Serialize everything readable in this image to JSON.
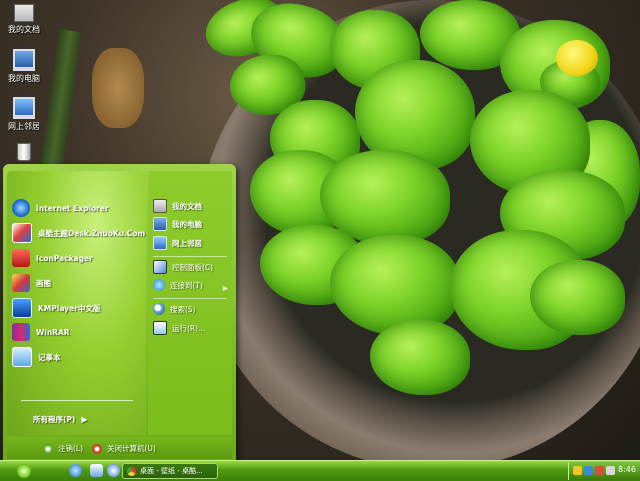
{
  "desktop": {
    "icons": [
      {
        "label": "我的文档",
        "icon": "documents-icon"
      },
      {
        "label": "我的电脑",
        "icon": "computer-icon"
      },
      {
        "label": "网上邻居",
        "icon": "network-icon"
      },
      {
        "label": "",
        "icon": "recycle-bin-icon"
      }
    ]
  },
  "start_menu": {
    "pinned": [
      {
        "label": "Internet Explorer",
        "icon": "ie-icon"
      },
      {
        "label": "桌酷主题Desk.ZhuoKu.Com",
        "icon": "zhuoku-icon"
      },
      {
        "label": "IconPackager",
        "icon": "iconpackager-icon"
      },
      {
        "label": "画图",
        "icon": "paint-icon"
      },
      {
        "label": "KMPlayer中文版",
        "icon": "kmplayer-icon"
      },
      {
        "label": "WinRAR",
        "icon": "winrar-icon"
      },
      {
        "label": "记事本",
        "icon": "notepad-icon"
      }
    ],
    "all_programs": "所有程序(P)",
    "all_programs_arrow": "▶",
    "right": {
      "my_documents": "我的文档",
      "my_computer": "我的电脑",
      "network": "网上邻居",
      "control_panel": "控制面板(C)",
      "connect_to": "连接到(T)",
      "connect_arrow": "▶",
      "search": "搜索(S)",
      "run": "运行(R)..."
    },
    "log_off": "注销(L)",
    "shut_down": "关闭计算机(U)"
  },
  "taskbar": {
    "task_button": "桌面 - 壁纸 - 桌酷...",
    "clock": "8:46"
  },
  "colors": {
    "accent": "#7bbd1c",
    "taskbar": "#4e9a10"
  }
}
